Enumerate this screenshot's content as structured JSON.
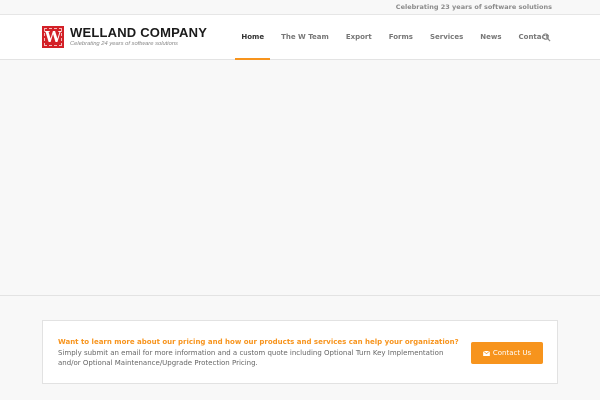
{
  "topbar": {
    "tagline": "Celebrating 23 years of software solutions"
  },
  "logo": {
    "mark_letter": "W",
    "title": "WELLAND COMPANY",
    "tagline": "Celebrating 24 years of software solutions"
  },
  "nav": {
    "items": [
      {
        "label": "Home",
        "active": true
      },
      {
        "label": "The W Team"
      },
      {
        "label": "Export"
      },
      {
        "label": "Forms"
      },
      {
        "label": "Services"
      },
      {
        "label": "News"
      },
      {
        "label": "Contact"
      }
    ],
    "search_icon": "search-icon"
  },
  "cta": {
    "heading": "Want to learn more about our pricing and how our products and services can help your organization?",
    "body": "Simply submit an email for more information and a custom quote including Optional Turn Key Implementation and/or Optional Maintenance/Upgrade Protection Pricing.",
    "button_label": "Contact Us",
    "button_icon": "mail-icon"
  },
  "colors": {
    "accent": "#f7941d",
    "brand_red": "#d32027",
    "background": "#f8f8f8"
  }
}
